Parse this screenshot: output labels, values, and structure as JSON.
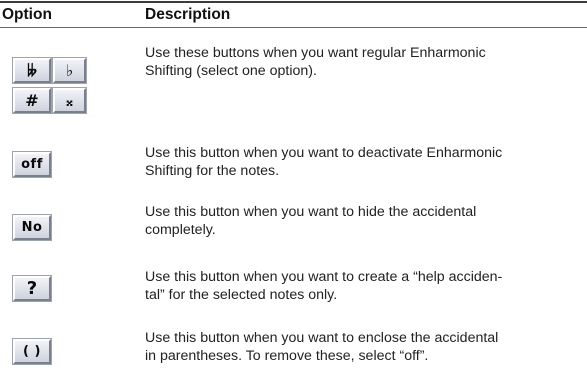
{
  "header": {
    "option": "Option",
    "description": "Description"
  },
  "rows": [
    {
      "buttons": [
        {
          "label": "𝄫",
          "icon": "double-flat-icon"
        },
        {
          "label": "♭",
          "icon": "flat-icon"
        },
        {
          "label": "#",
          "icon": "sharp-icon"
        },
        {
          "label": "𝄪",
          "icon": "double-sharp-icon"
        }
      ],
      "description": "Use these buttons when you want regular Enharmonic\nShifting (select one option)."
    },
    {
      "buttons": [
        {
          "label": "off",
          "icon": "off-icon"
        }
      ],
      "description": "Use this button when you want to deactivate Enharmonic\nShifting for the notes."
    },
    {
      "buttons": [
        {
          "label": "No",
          "icon": "no-accidental-icon"
        }
      ],
      "description": "Use this button when you want to hide the accidental\ncompletely."
    },
    {
      "buttons": [
        {
          "label": "?",
          "icon": "help-accidental-icon"
        }
      ],
      "description": "Use this button when you want to create a “help acciden-\ntal” for the selected notes only."
    },
    {
      "buttons": [
        {
          "label": "( )",
          "icon": "parentheses-icon"
        }
      ],
      "description": "Use this button when you want to enclose the accidental\nin parentheses. To remove these, select “off”."
    }
  ]
}
